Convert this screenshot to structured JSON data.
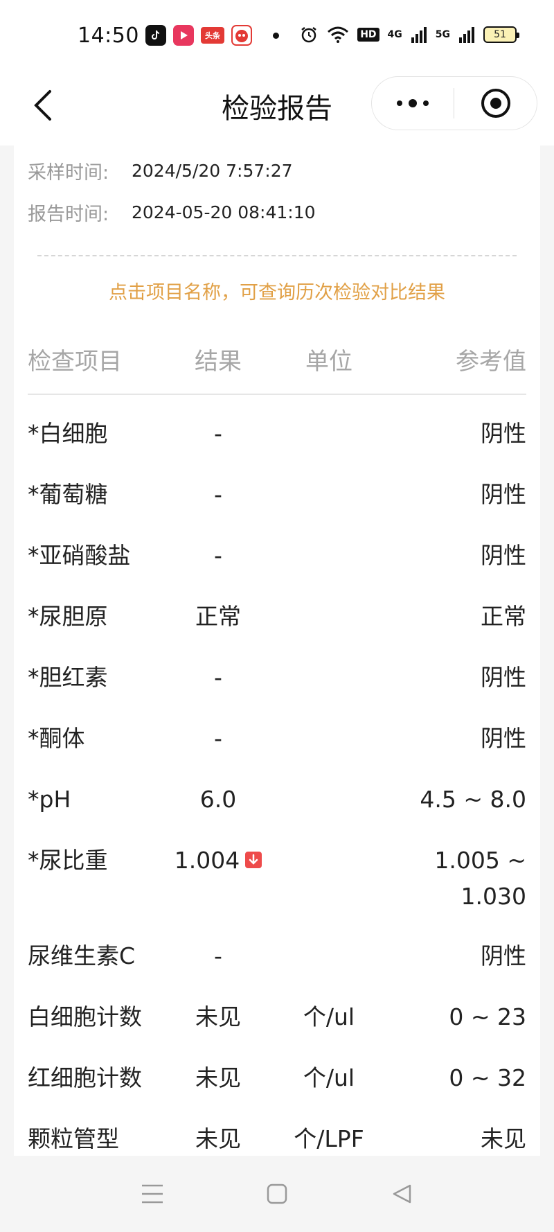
{
  "status_bar": {
    "time": "14:50",
    "app_icons": [
      "tiktok-icon",
      "video-icon",
      "toutiao-icon",
      "mascot-icon"
    ],
    "toutiao_text": "头条",
    "hd_text": "HD",
    "net1": "4G",
    "net2": "5G",
    "battery": "51"
  },
  "nav": {
    "title": "检验报告"
  },
  "meta": {
    "sample_label": "采样时间:",
    "sample_value": "2024/5/20 7:57:27",
    "report_label": "报告时间:",
    "report_value": "2024-05-20 08:41:10"
  },
  "hint": "点击项目名称，可查询历次检验对比结果",
  "table": {
    "headers": {
      "name": "检查项目",
      "result": "结果",
      "unit": "单位",
      "ref": "参考值"
    },
    "rows": [
      {
        "name": "*白细胞",
        "result": "-",
        "unit": "",
        "ref": "阴性"
      },
      {
        "name": "*葡萄糖",
        "result": "-",
        "unit": "",
        "ref": "阴性"
      },
      {
        "name": "*亚硝酸盐",
        "result": "-",
        "unit": "",
        "ref": "阴性"
      },
      {
        "name": "*尿胆原",
        "result": "正常",
        "unit": "",
        "ref": "正常"
      },
      {
        "name": "*胆红素",
        "result": "-",
        "unit": "",
        "ref": "阴性"
      },
      {
        "name": "*酮体",
        "result": "-",
        "unit": "",
        "ref": "阴性"
      },
      {
        "name": "*pH",
        "result": "6.0",
        "unit": "",
        "ref": "4.5 ~ 8.0"
      },
      {
        "name": "*尿比重",
        "result": "1.004",
        "unit": "",
        "ref": "1.005 ~",
        "ref2": "1.030",
        "flag": "low"
      },
      {
        "name": "尿维生素C",
        "result": "-",
        "unit": "",
        "ref": "阴性"
      },
      {
        "name": "白细胞计数",
        "result": "未见",
        "unit": "个/ul",
        "ref": "0 ~ 23"
      },
      {
        "name": "红细胞计数",
        "result": "未见",
        "unit": "个/ul",
        "ref": "0 ~ 32"
      },
      {
        "name": "颗粒管型",
        "result": "未见",
        "unit": "个/LPF",
        "ref": "未见"
      }
    ]
  },
  "colors": {
    "hint": "#e1a046",
    "flag_low": "#ee4b4b",
    "header_text": "#a6a6a6"
  }
}
